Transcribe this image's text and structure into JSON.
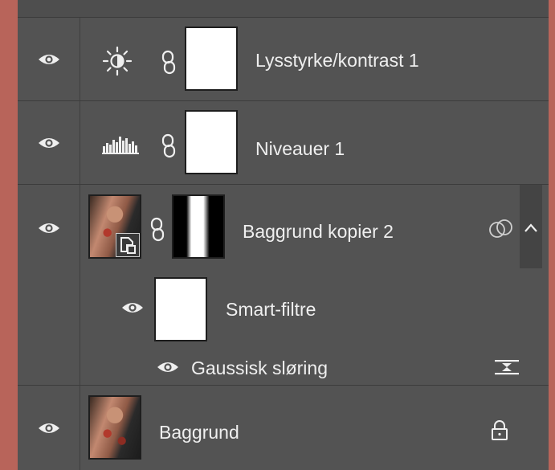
{
  "layers": [
    {
      "name": "Lysstyrke/kontrast 1",
      "type": "brightness-contrast-adjustment",
      "icon": "sun-icon"
    },
    {
      "name": "Niveauer 1",
      "type": "levels-adjustment",
      "icon": "histogram-icon"
    },
    {
      "name": "Baggrund kopier 2",
      "type": "smart-object",
      "icon": "smart-object-badge-icon"
    },
    {
      "name": "Baggrund",
      "type": "background",
      "icon": "lock-icon"
    }
  ],
  "smart_filters": {
    "label": "Smart-filtre",
    "filters": [
      {
        "name": "Gaussisk sløring"
      }
    ]
  },
  "colors": {
    "panel": "#535353",
    "border": "#3c3c3c",
    "text": "#efefef",
    "backdrop": "#b8645a"
  }
}
